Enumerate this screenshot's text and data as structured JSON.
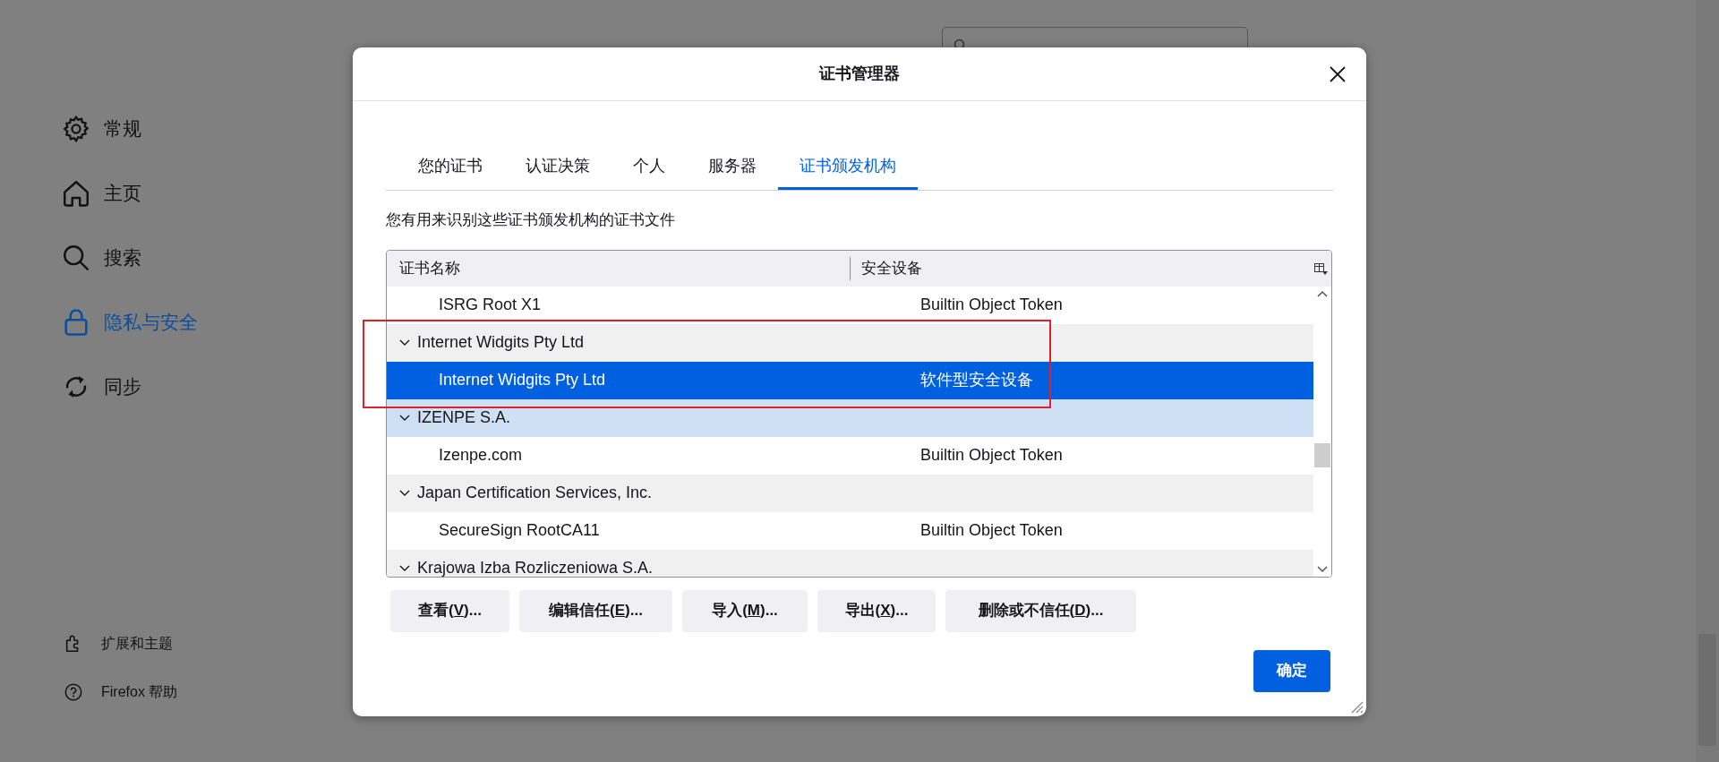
{
  "sidebar": {
    "items": [
      {
        "label": "常规",
        "selected": false
      },
      {
        "label": "主页",
        "selected": false
      },
      {
        "label": "搜索",
        "selected": false
      },
      {
        "label": "隐私与安全",
        "selected": true
      },
      {
        "label": "同步",
        "selected": false
      }
    ],
    "footer_items": [
      {
        "label": "扩展和主题"
      },
      {
        "label": "Firefox 帮助"
      }
    ]
  },
  "dialog": {
    "title": "证书管理器",
    "tabs": [
      {
        "label": "您的证书",
        "selected": false
      },
      {
        "label": "认证决策",
        "selected": false
      },
      {
        "label": "个人",
        "selected": false
      },
      {
        "label": "服务器",
        "selected": false
      },
      {
        "label": "证书颁发机构",
        "selected": true
      }
    ],
    "description": "您有用来识别这些证书颁发机构的证书文件",
    "table": {
      "columns": [
        "证书名称",
        "安全设备"
      ],
      "rows": [
        {
          "kind": "child",
          "name": "ISRG Root X1",
          "device": "Builtin Object Token",
          "selected": false,
          "hovered": false
        },
        {
          "kind": "group",
          "name": "Internet Widgits Pty Ltd",
          "expanded": true,
          "selected": false,
          "hovered": false
        },
        {
          "kind": "child",
          "name": "Internet Widgits Pty Ltd",
          "device": "软件型安全设备",
          "selected": true,
          "hovered": false
        },
        {
          "kind": "group",
          "name": "IZENPE S.A.",
          "expanded": true,
          "selected": false,
          "hovered": true
        },
        {
          "kind": "child",
          "name": "Izenpe.com",
          "device": "Builtin Object Token",
          "selected": false,
          "hovered": false
        },
        {
          "kind": "group",
          "name": "Japan Certification Services, Inc.",
          "expanded": true,
          "selected": false,
          "hovered": false
        },
        {
          "kind": "child",
          "name": "SecureSign RootCA11",
          "device": "Builtin Object Token",
          "selected": false,
          "hovered": false
        },
        {
          "kind": "group",
          "name": "Krajowa Izba Rozliczeniowa S.A.",
          "expanded": true,
          "selected": false,
          "hovered": false
        }
      ]
    },
    "buttons": [
      {
        "text_before": "查看(",
        "access_key": "V",
        "text_after": ")..."
      },
      {
        "text_before": "编辑信任(",
        "access_key": "E",
        "text_after": ")..."
      },
      {
        "text_before": "导入(",
        "access_key": "M",
        "text_after": ")..."
      },
      {
        "text_before": "导出(",
        "access_key": "X",
        "text_after": ")..."
      },
      {
        "text_before": "删除或不信任(",
        "access_key": "D",
        "text_after": ")..."
      }
    ],
    "ok_button": "确定"
  }
}
